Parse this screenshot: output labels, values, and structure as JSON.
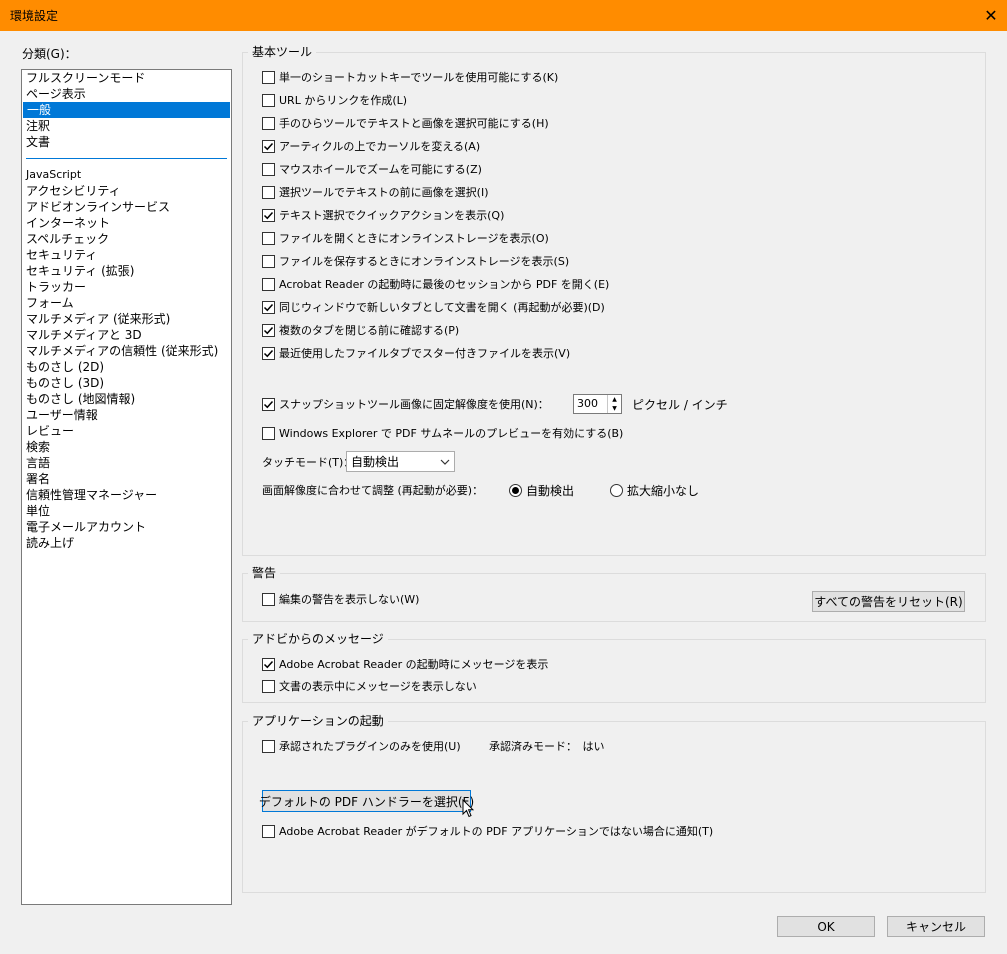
{
  "window": {
    "title": "環境設定",
    "close_label": "✕"
  },
  "category_label": "分類(G)：",
  "categories_top": [
    "フルスクリーンモード",
    "ページ表示",
    "一般",
    "注釈",
    "文書"
  ],
  "selected_category": "一般",
  "categories_bottom": [
    "JavaScript",
    "アクセシビリティ",
    "アドビオンラインサービス",
    "インターネット",
    "スペルチェック",
    "セキュリティ",
    "セキュリティ (拡張)",
    "トラッカー",
    "フォーム",
    "マルチメディア (従来形式)",
    "マルチメディアと 3D",
    "マルチメディアの信頼性 (従来形式)",
    "ものさし (2D)",
    "ものさし (3D)",
    "ものさし (地図情報)",
    "ユーザー情報",
    "レビュー",
    "検索",
    "言語",
    "署名",
    "信頼性管理マネージャー",
    "単位",
    "電子メールアカウント",
    "読み上げ"
  ],
  "basic_tools": {
    "label": "基本ツール",
    "options": [
      {
        "text": "単一のショートカットキーでツールを使用可能にする(K)",
        "checked": false
      },
      {
        "text": "URL からリンクを作成(L)",
        "checked": false
      },
      {
        "text": "手のひらツールでテキストと画像を選択可能にする(H)",
        "checked": false
      },
      {
        "text": "アーティクルの上でカーソルを変える(A)",
        "checked": true
      },
      {
        "text": "マウスホイールでズームを可能にする(Z)",
        "checked": false
      },
      {
        "text": "選択ツールでテキストの前に画像を選択(I)",
        "checked": false
      },
      {
        "text": "テキスト選択でクイックアクションを表示(Q)",
        "checked": true
      },
      {
        "text": "ファイルを開くときにオンラインストレージを表示(O)",
        "checked": false
      },
      {
        "text": "ファイルを保存するときにオンラインストレージを表示(S)",
        "checked": false
      },
      {
        "text": "Acrobat Reader の起動時に最後のセッションから PDF を開く(E)",
        "checked": false
      },
      {
        "text": "同じウィンドウで新しいタブとして文書を開く (再起動が必要)(D)",
        "checked": true
      },
      {
        "text": "複数のタブを閉じる前に確認する(P)",
        "checked": true
      },
      {
        "text": "最近使用したファイルタブでスター付きファイルを表示(V)",
        "checked": true
      }
    ],
    "snapshot": {
      "text": "スナップショットツール画像に固定解像度を使用(N)：",
      "checked": true,
      "value": "300",
      "unit": "ピクセル / インチ"
    },
    "thumbnail": {
      "text": "Windows Explorer で PDF サムネールのプレビューを有効にする(B)",
      "checked": false
    },
    "touch_mode": {
      "label": "タッチモード(T)：",
      "value": "自動検出"
    },
    "resolution": {
      "label": "画面解像度に合わせて調整 (再起動が必要)：",
      "options": [
        "自動検出",
        "拡大縮小なし"
      ],
      "selected": "自動検出"
    }
  },
  "warnings": {
    "label": "警告",
    "option": {
      "text": "編集の警告を表示しない(W)",
      "checked": false
    },
    "reset_button": "すべての警告をリセット(R)"
  },
  "adobe_messages": {
    "label": "アドビからのメッセージ",
    "options": [
      {
        "text": "Adobe Acrobat Reader の起動時にメッセージを表示",
        "checked": true
      },
      {
        "text": "文書の表示中にメッセージを表示しない",
        "checked": false
      }
    ]
  },
  "app_startup": {
    "label": "アプリケーションの起動",
    "plugins": {
      "text": "承認されたプラグインのみを使用(U)",
      "checked": false
    },
    "certified_mode": "承認済みモード：　はい",
    "default_handler_button": "デフォルトの PDF ハンドラーを選択(F)",
    "notify": {
      "text": "Adobe Acrobat Reader がデフォルトの PDF アプリケーションではない場合に通知(T)",
      "checked": false
    }
  },
  "footer": {
    "ok": "OK",
    "cancel": "キャンセル"
  }
}
